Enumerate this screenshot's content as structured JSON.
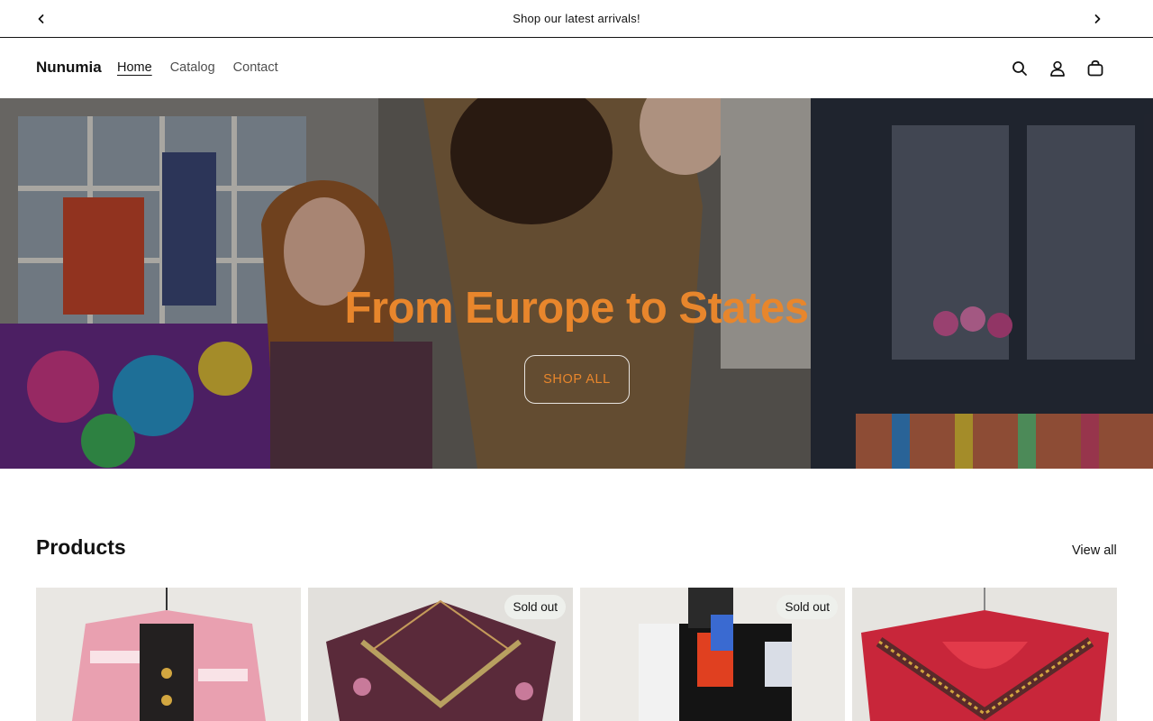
{
  "announcement": {
    "text": "Shop our latest arrivals!",
    "prev_icon": "chevron-left-icon",
    "next_icon": "chevron-right-icon"
  },
  "header": {
    "logo": "Nunumia",
    "nav": [
      {
        "label": "Home",
        "active": true
      },
      {
        "label": "Catalog",
        "active": false
      },
      {
        "label": "Contact",
        "active": false
      }
    ],
    "icons": [
      "search-icon",
      "account-icon",
      "cart-icon"
    ]
  },
  "hero": {
    "title": "From Europe to States",
    "button_label": "SHOP ALL",
    "accent_color": "#e8862c"
  },
  "products": {
    "title": "Products",
    "view_all_label": "View all",
    "items": [
      {
        "name": "pink-newsprint-jacket",
        "badge": ""
      },
      {
        "name": "floral-velvet-dress",
        "badge": "Sold out"
      },
      {
        "name": "abstract-print-turtleneck",
        "badge": "Sold out"
      },
      {
        "name": "red-embellished-dress",
        "badge": ""
      }
    ]
  }
}
